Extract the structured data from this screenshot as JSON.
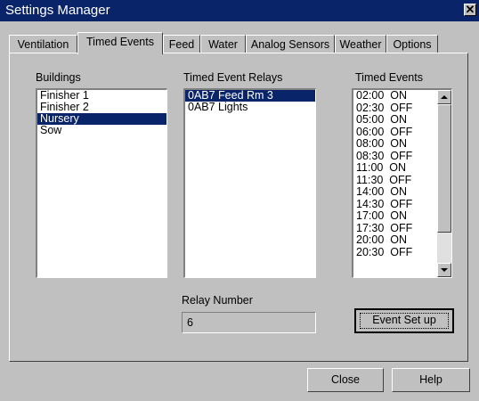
{
  "window": {
    "title": "Settings Manager"
  },
  "tabs": [
    {
      "label": "Ventilation",
      "active": false
    },
    {
      "label": "Timed Events",
      "active": true
    },
    {
      "label": "Feed",
      "active": false
    },
    {
      "label": "Water",
      "active": false
    },
    {
      "label": "Analog Sensors",
      "active": false
    },
    {
      "label": "Weather",
      "active": false
    },
    {
      "label": "Options",
      "active": false
    }
  ],
  "buildings": {
    "label": "Buildings",
    "items": [
      "Finisher 1",
      "Finisher 2",
      "Nursery",
      "Sow"
    ],
    "selected": "Nursery"
  },
  "relays": {
    "label": "Timed Event Relays",
    "items": [
      "0AB7 Feed Rm 3",
      "0AB7 Lights"
    ],
    "selected": "0AB7 Feed Rm 3"
  },
  "events": {
    "label": "Timed Events",
    "items": [
      "02:00  ON",
      "02:30  OFF",
      "05:00  ON",
      "06:00  OFF",
      "08:00  ON",
      "08:30  OFF",
      "11:00  ON",
      "11:30  OFF",
      "14:00  ON",
      "14:30  OFF",
      "17:00  ON",
      "17:30  OFF",
      "20:00  ON",
      "20:30  OFF"
    ]
  },
  "relay_number": {
    "label": "Relay Number",
    "value": "6"
  },
  "buttons": {
    "event_setup": "Event Set up",
    "close": "Close",
    "help": "Help"
  },
  "icons": {
    "close": "close-icon",
    "scroll_up": "scroll-up-icon",
    "scroll_down": "scroll-down-icon"
  }
}
